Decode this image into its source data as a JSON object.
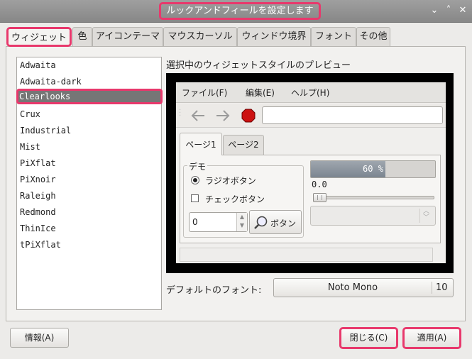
{
  "window": {
    "title": "ルックアンドフィールを設定します",
    "controls": {
      "menu": "⌄",
      "minimize": "˄",
      "close": "✕"
    }
  },
  "tabs": [
    {
      "label": "ウィジェット",
      "active": true
    },
    {
      "label": "色"
    },
    {
      "label": "アイコンテーマ"
    },
    {
      "label": "マウスカーソル"
    },
    {
      "label": "ウィンドウ境界"
    },
    {
      "label": "フォント"
    },
    {
      "label": "その他"
    }
  ],
  "themes": {
    "items": [
      "Adwaita",
      "Adwaita-dark",
      "Clearlooks",
      "Crux",
      "Industrial",
      "Mist",
      "PiXflat",
      "PiXnoir",
      "Raleigh",
      "Redmond",
      "ThinIce",
      "tPiXflat"
    ],
    "selected": "Clearlooks"
  },
  "preview": {
    "heading": "選択中のウィジェットスタイルのプレビュー",
    "menus": [
      "ファイル(F)",
      "編集(E)",
      "ヘルプ(H)"
    ],
    "tabs": [
      "ページ1",
      "ページ2"
    ],
    "demo_label": "デモ",
    "radio_label": "ラジオボタン",
    "check_label": "チェックボタン",
    "spin_value": "0",
    "button_label": "ボタン",
    "progress_text": "60 %",
    "progress_value": 0.6,
    "slider_value_text": "0.0",
    "slider_value": 0.0
  },
  "font": {
    "label": "デフォルトのフォント:",
    "name": "Noto Mono",
    "size": "10"
  },
  "footer": {
    "info_label": "情報(A)",
    "close_label": "閉じる(C)",
    "apply_label": "適用(A)"
  },
  "colors": {
    "highlight": "#e8386c",
    "selection": "#767676"
  }
}
